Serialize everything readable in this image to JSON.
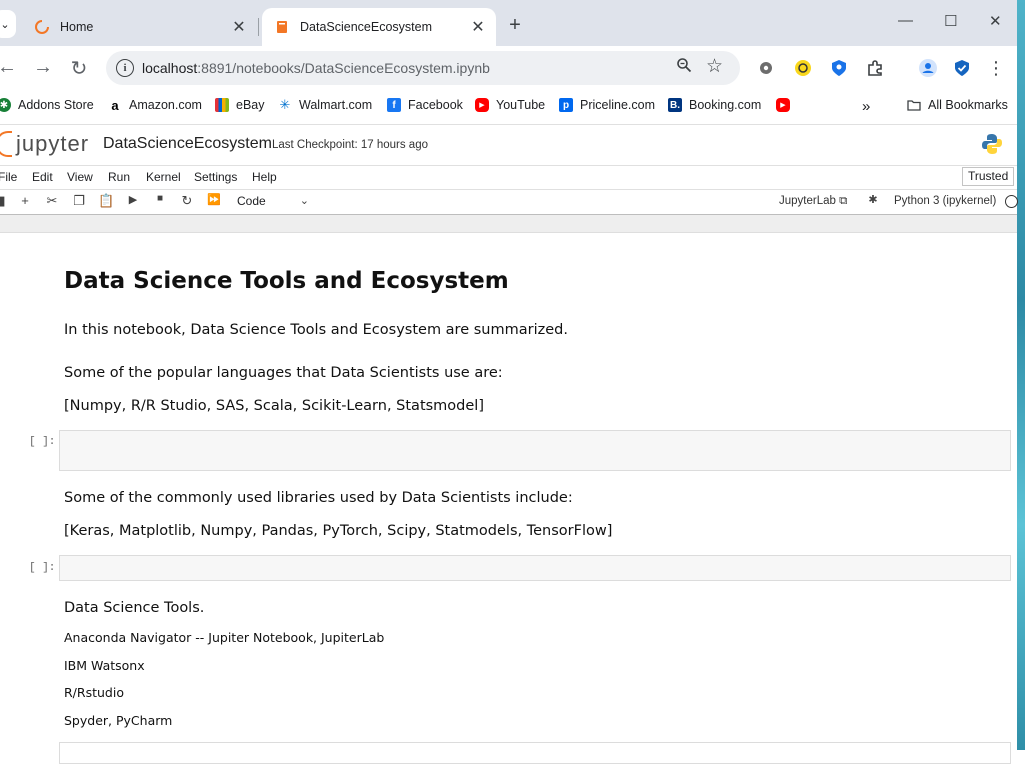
{
  "browser": {
    "tabs": [
      {
        "title": "Home"
      },
      {
        "title": "DataScienceEcosystem"
      }
    ],
    "url_host": "localhost",
    "url_rest": ":8891/notebooks/DataScienceEcosystem.ipynb",
    "bookmarks": [
      {
        "label": "Addons Store",
        "icon": "addons-store-icon",
        "color": "#188038"
      },
      {
        "label": "Amazon.com",
        "icon": "amazon-icon",
        "color": "#000000"
      },
      {
        "label": "eBay",
        "icon": "ebay-icon",
        "color": "#e53238"
      },
      {
        "label": "Walmart.com",
        "icon": "walmart-icon",
        "color": "#0071ce"
      },
      {
        "label": "Facebook",
        "icon": "facebook-icon",
        "color": "#1877f2"
      },
      {
        "label": "YouTube",
        "icon": "youtube-icon",
        "color": "#ff0000"
      },
      {
        "label": "Priceline.com",
        "icon": "priceline-icon",
        "color": "#0068ef"
      },
      {
        "label": "Booking.com",
        "icon": "booking-icon",
        "color": "#003580"
      }
    ],
    "all_bookmarks": "All Bookmarks"
  },
  "jupyter": {
    "logo_text": "jupyter",
    "notebook_title": "DataScienceEcosystem",
    "checkpoint": "Last Checkpoint: 17 hours ago",
    "menu": [
      "File",
      "Edit",
      "View",
      "Run",
      "Kernel",
      "Settings",
      "Help"
    ],
    "trusted": "Trusted",
    "cell_type": "Code",
    "jupyterlab_link": "JupyterLab",
    "kernel": "Python 3 (ipykernel)",
    "accent_color": "#f37726"
  },
  "notebook": {
    "title": "Data Science Tools and Ecosystem",
    "intro": "In this notebook, Data Science Tools and Ecosystem are summarized.",
    "languages_heading": "Some of the popular languages that Data Scientists use are:",
    "languages_list": "[Numpy, R/R Studio, SAS, Scala, Scikit-Learn, Statsmodel]",
    "prompt": "[ ]:",
    "libraries_heading": "Some of the commonly used libraries used by Data Scientists include:",
    "libraries_list": "[Keras, Matplotlib, Numpy, Pandas, PyTorch, Scipy, Statmodels, TensorFlow]",
    "tools_heading": "Data Science Tools.",
    "tools": [
      "Anaconda Navigator -- Jupiter Notebook, JupiterLab",
      "IBM Watsonx",
      "R/Rstudio",
      "Spyder, PyCharm"
    ]
  }
}
